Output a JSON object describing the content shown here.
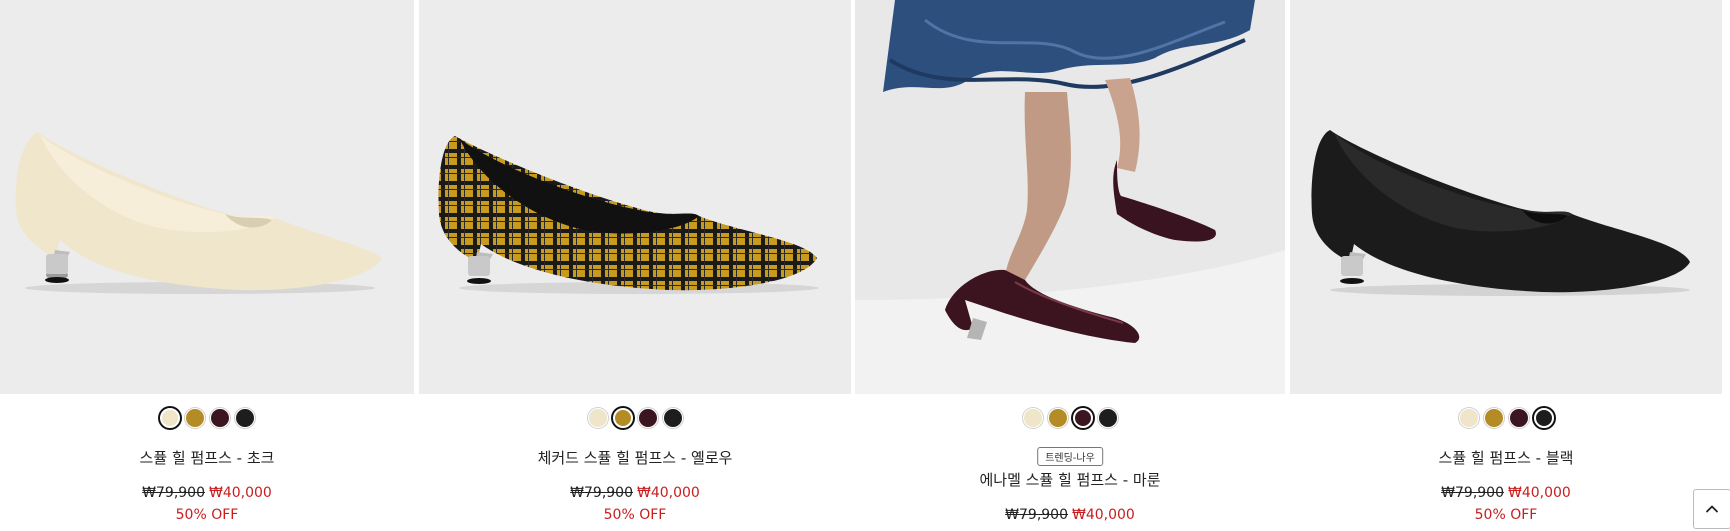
{
  "products": [
    {
      "name": "스퓰 힐 펌프스 - 초크",
      "badge": "",
      "original_price": "₩79,900",
      "sale_price": "₩40,000",
      "discount": "50% OFF",
      "swatches": [
        {
          "color": "#efe5c8",
          "selected": true
        },
        {
          "color": "#b38c25",
          "selected": false
        },
        {
          "color": "#3b1620",
          "selected": false
        },
        {
          "color": "#1d1d1d",
          "selected": false
        }
      ],
      "image_icon": "cream-pump-shoe-image"
    },
    {
      "name": "체커드 스퓰 힐 펌프스 - 옐로우",
      "badge": "",
      "original_price": "₩79,900",
      "sale_price": "₩40,000",
      "discount": "50% OFF",
      "swatches": [
        {
          "color": "#efe5c8",
          "selected": false
        },
        {
          "color": "#b38c25",
          "selected": true
        },
        {
          "color": "#3b1620",
          "selected": false
        },
        {
          "color": "#1d1d1d",
          "selected": false
        }
      ],
      "image_icon": "checkered-pump-shoe-image"
    },
    {
      "name": "에나멜 스퓰 힐 펌프스 - 마룬",
      "badge": "트렌딩-나우",
      "original_price": "₩79,900",
      "sale_price": "₩40,000",
      "discount": "",
      "swatches": [
        {
          "color": "#efe5c8",
          "selected": false
        },
        {
          "color": "#b38c25",
          "selected": false
        },
        {
          "color": "#3b1620",
          "selected": true
        },
        {
          "color": "#1d1d1d",
          "selected": false
        }
      ],
      "image_icon": "model-wearing-maroon-pumps-image"
    },
    {
      "name": "스퓰 힐 펌프스 - 블랙",
      "badge": "",
      "original_price": "₩79,900",
      "sale_price": "₩40,000",
      "discount": "50% OFF",
      "swatches": [
        {
          "color": "#efe5c8",
          "selected": false
        },
        {
          "color": "#b38c25",
          "selected": false
        },
        {
          "color": "#3b1620",
          "selected": false
        },
        {
          "color": "#1d1d1d",
          "selected": true
        }
      ],
      "image_icon": "black-pump-shoe-image"
    }
  ],
  "scroll_top_icon": "chevron-up-icon"
}
